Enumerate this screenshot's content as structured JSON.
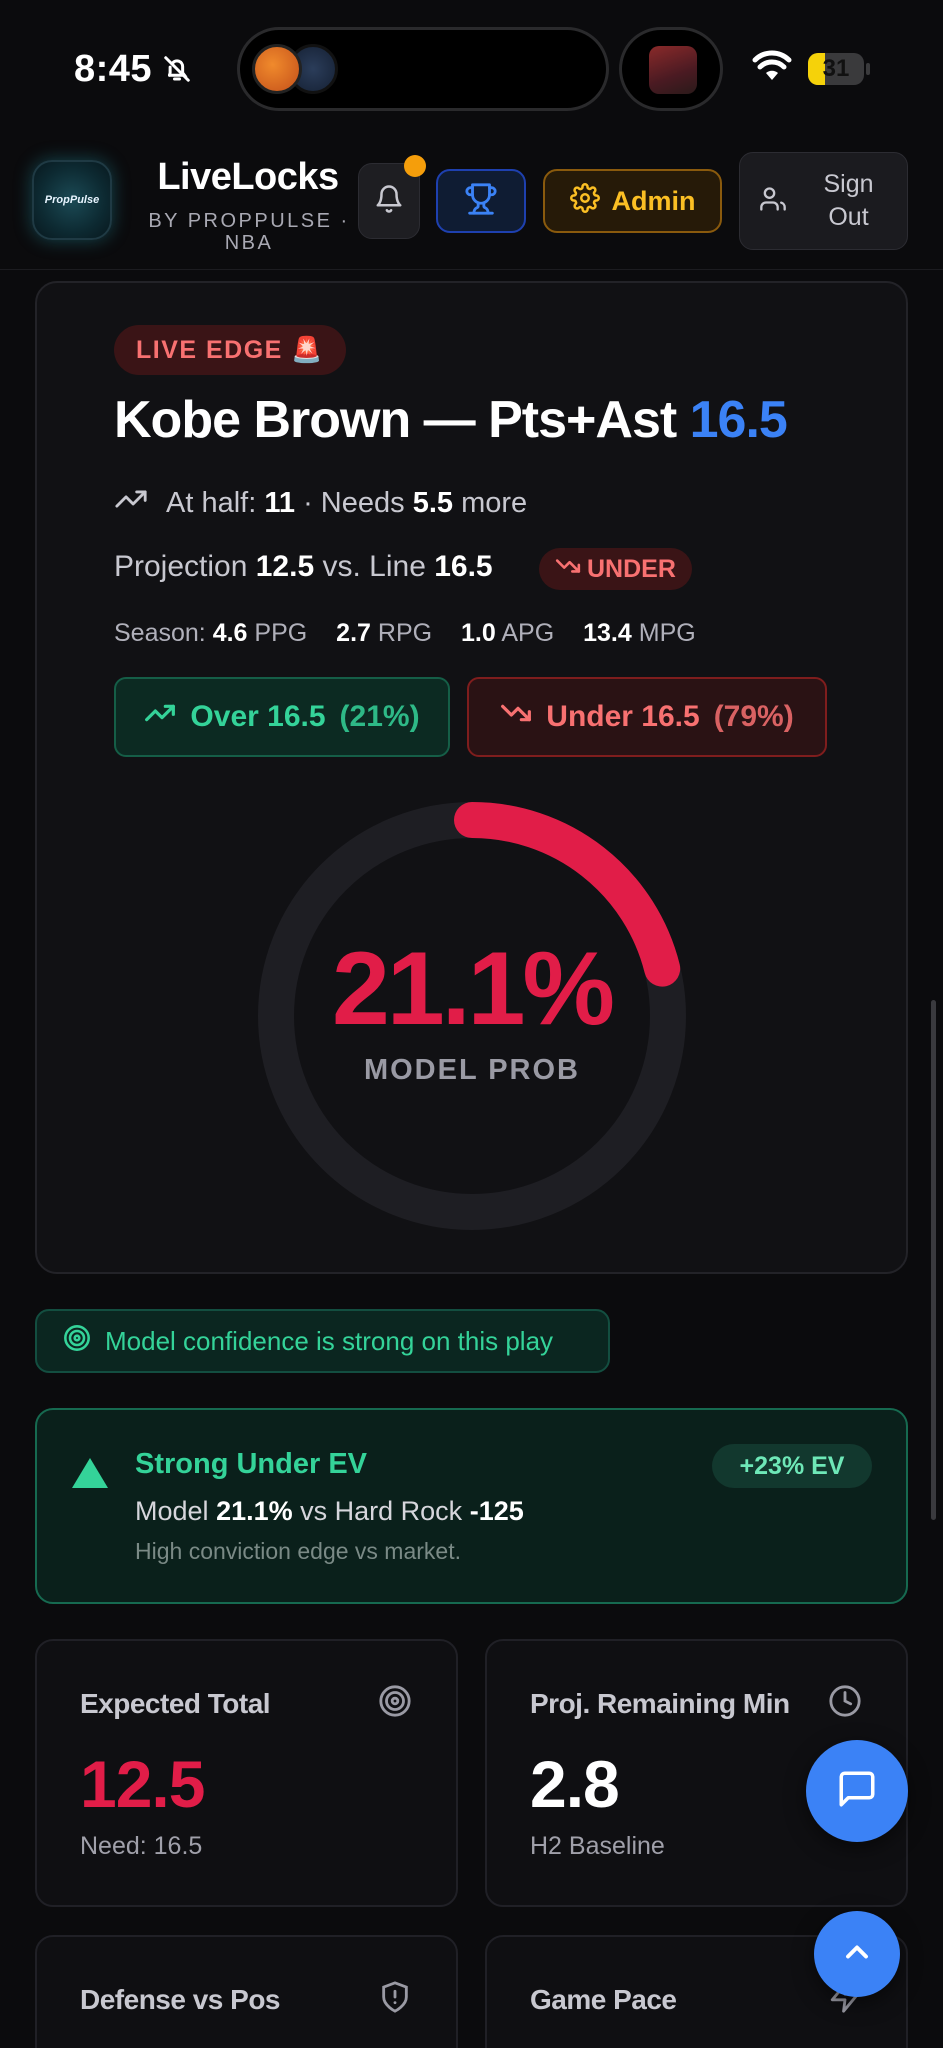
{
  "status_bar": {
    "time": "8:45",
    "battery": "31",
    "battery_level": 0.31
  },
  "header": {
    "brand_title": "LiveLocks",
    "brand_subtitle": "BY PROPPULSE · NBA",
    "logo_text": "PropPulse",
    "admin_label": "Admin",
    "signout_label": "Sign Out"
  },
  "play": {
    "live_badge": "LIVE EDGE 🚨",
    "player_stat": "Kobe Brown — Pts+Ast",
    "line": "16.5",
    "half_prefix": "At half:",
    "half_value": "11",
    "needs_prefix": "· Needs",
    "needs_value": "5.5",
    "needs_suffix": "more",
    "projection_prefix": "Projection",
    "projection_value": "12.5",
    "vs_line_label": "vs. Line",
    "vs_line_value": "16.5",
    "direction": "UNDER",
    "season_label": "Season:",
    "ppg": "4.6",
    "ppg_unit": "PPG",
    "rpg": "2.7",
    "rpg_unit": "RPG",
    "apg": "1.0",
    "apg_unit": "APG",
    "mpg": "13.4",
    "mpg_unit": "MPG",
    "over_label": "Over 16.5",
    "over_pct": "(21%)",
    "under_label": "Under 16.5",
    "under_pct": "(79%)",
    "model_prob": "21.1%",
    "model_prob_value": 0.211,
    "model_prob_label": "MODEL PROB"
  },
  "confidence": {
    "text": "Model confidence is strong on this play"
  },
  "ev": {
    "title": "Strong Under EV",
    "model_label": "Model",
    "model_value": "21.1%",
    "vs_book": "vs Hard Rock",
    "odds": "-125",
    "note": "High conviction edge vs market.",
    "badge": "+23% EV"
  },
  "stats": [
    {
      "label": "Expected Total",
      "value": "12.5",
      "sub": "Need: 16.5",
      "icon": "target-icon"
    },
    {
      "label": "Proj. Remaining Min",
      "value": "2.8",
      "sub": "H2 Baseline",
      "icon": "clock-icon"
    },
    {
      "label": "Defense vs Pos",
      "icon": "shield-icon"
    },
    {
      "label": "Game Pace",
      "icon": "zap-icon"
    }
  ],
  "colors": {
    "accent_blue": "#3b82f6",
    "accent_red": "#e11d48",
    "accent_green": "#34d399",
    "accent_amber": "#fbbf24"
  }
}
